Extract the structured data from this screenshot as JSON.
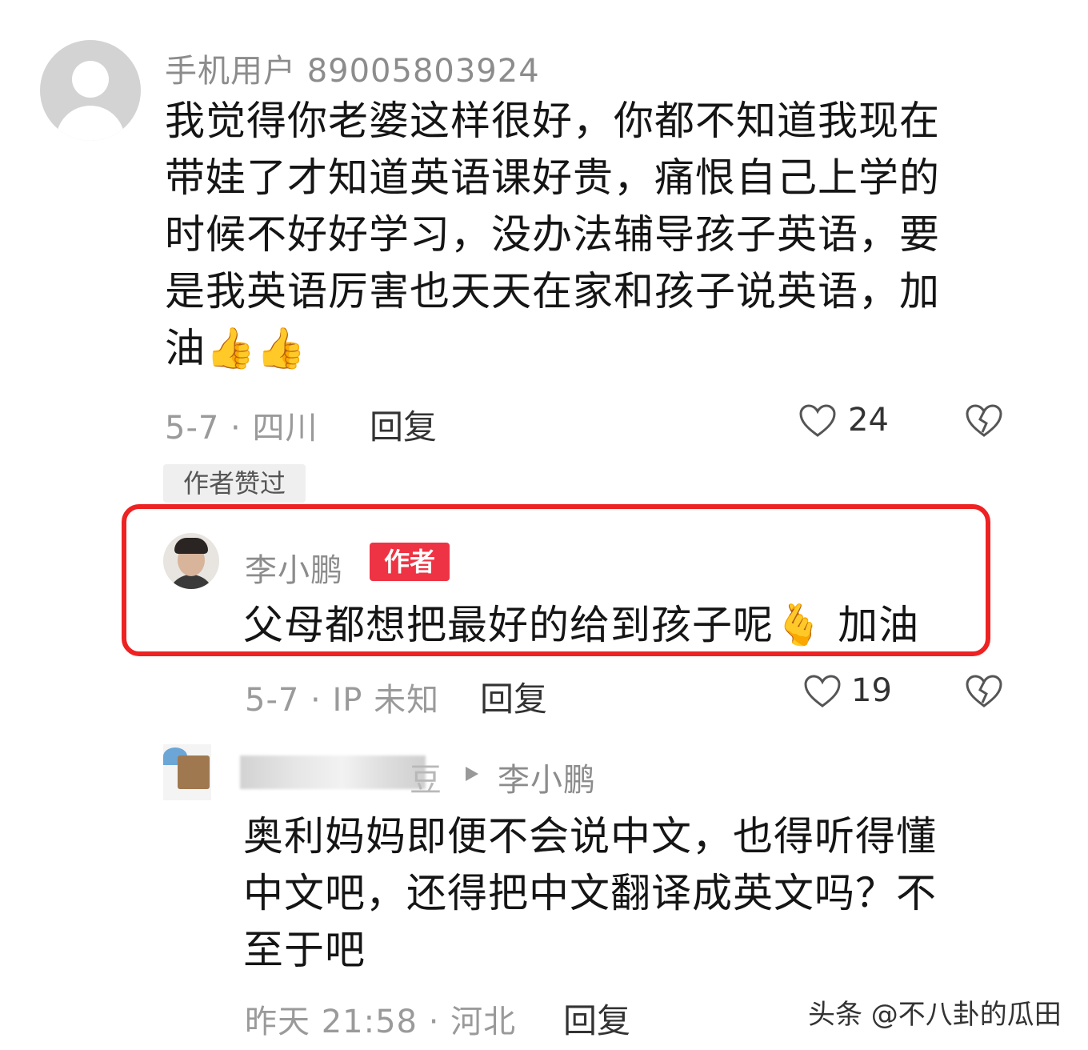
{
  "comments": [
    {
      "username": "手机用户 89005803924",
      "text_lines": [
        "我觉得你老婆这样很好，你都不知道我现在",
        "带娃了才知道英语课好贵，痛恨自己上学的",
        "时候不好好学习，没办法辅导孩子英语，要",
        "是我英语厉害也天天在家和孩子说英语，加",
        "油"
      ],
      "emoji": "👍👍",
      "meta": "5-7 · 四川",
      "reply_label": "回复",
      "likes": "24",
      "badge": "作者赞过"
    },
    {
      "username": "李小鹏",
      "author_tag": "作者",
      "text": "父母都想把最好的给到孩子呢",
      "emoji": "🫰",
      "text_tail": "加油",
      "meta": "5-7 · IP 未知",
      "reply_label": "回复",
      "likes": "19"
    },
    {
      "username_tail": "豆",
      "reply_to": "李小鹏",
      "text_lines": [
        "奥利妈妈即便不会说中文，也得听得懂",
        "中文吧，还得把中文翻译成英文吗？不",
        "至于吧"
      ],
      "meta": "昨天 21:58 · 河北",
      "reply_label": "回复"
    }
  ],
  "watermark": "头条 @不八卦的瓜田",
  "colors": {
    "author_tag": "#ee3344",
    "highlight_border": "#ee2222"
  }
}
